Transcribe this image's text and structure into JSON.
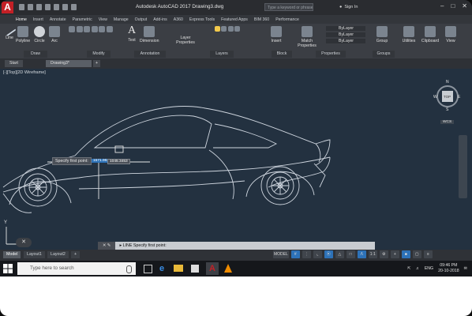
{
  "app": {
    "logo_text": "A",
    "title": "Autodesk AutoCAD 2017   Drawing3.dwg",
    "search_placeholder": "Type a keyword or phrase",
    "signin": "Sign In"
  },
  "menu_tabs": [
    "Home",
    "Insert",
    "Annotate",
    "Parametric",
    "View",
    "Manage",
    "Output",
    "Add-ins",
    "A360",
    "Express Tools",
    "Featured Apps",
    "BIM 360",
    "Performance"
  ],
  "ribbon": {
    "draw_buttons": [
      "Line",
      "Polyline",
      "Circle",
      "Arc"
    ],
    "text_button": "Text",
    "dimension_button": "Dimension",
    "layer_properties": "Layer Properties",
    "insert_button": "Insert",
    "match_properties": "Match Properties",
    "bylayer": [
      "ByLayer",
      "ByLayer",
      "ByLayer"
    ],
    "group_button": "Group",
    "utilities_button": "Utilities",
    "clipboard_button": "Clipboard",
    "view_button": "View",
    "panels": [
      "Draw",
      "Modify",
      "Annotation",
      "Layers",
      "Block",
      "Properties",
      "Groups"
    ]
  },
  "doc_tabs": [
    "Start",
    "Drawing3*"
  ],
  "viewport": {
    "label": "[-][Top][2D Wireframe]",
    "compass": {
      "n": "N",
      "s": "S",
      "e": "E",
      "w": "W",
      "top": "TOP",
      "wcs": "WCS"
    },
    "prompt_tooltip": "Specify first point:",
    "coord_x": "1571.9627",
    "coord_y": "1045.3453",
    "ucs_y": "Y"
  },
  "command_line": {
    "text": "LINE Specify first point:"
  },
  "layout_tabs": [
    "Model",
    "Layout1",
    "Layout2"
  ],
  "status": {
    "model": "MODEL",
    "scale": "1:1"
  },
  "taskbar": {
    "search_placeholder": "Type here to search",
    "lang": "ENG",
    "time": "09:46 PM",
    "date": "20-10-2018"
  },
  "colors": {
    "drawing_bg": "#233140",
    "ribbon_bg": "#3b3e44",
    "accent": "#2d72b8",
    "autocad_red": "#c32026"
  }
}
